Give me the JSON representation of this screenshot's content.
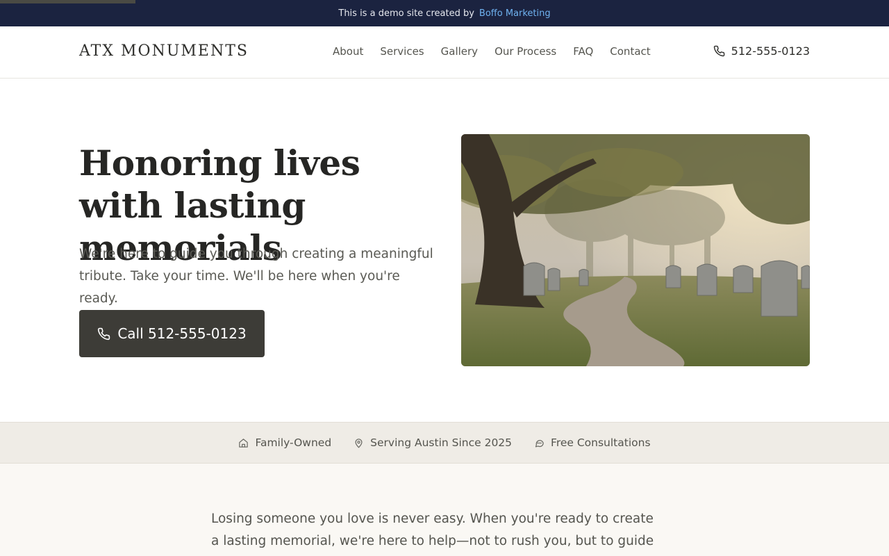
{
  "banner": {
    "text": "This is a demo site created by",
    "link": "Boffo Marketing"
  },
  "header": {
    "logo": "ATX MONUMENTS",
    "nav": [
      "About",
      "Services",
      "Gallery",
      "Our Process",
      "FAQ",
      "Contact"
    ],
    "phone": "512-555-0123"
  },
  "hero": {
    "title": "Honoring lives with lasting memorials",
    "subtitle": "We're here to guide you through creating a meaningful tribute. Take your time. We'll be here when you're ready.",
    "cta": "Call 512-555-0123",
    "image_icon": "cemetery-path-photo"
  },
  "trust": [
    {
      "icon": "home-icon",
      "label": "Family-Owned"
    },
    {
      "icon": "location-pin-icon",
      "label": "Serving Austin Since 2025"
    },
    {
      "icon": "chat-bubble-icon",
      "label": "Free Consultations"
    }
  ],
  "intro": {
    "text": "Losing someone you love is never easy. When you're ready to create a lasting memorial, we're here to help—not to rush you, but to guide you"
  },
  "colors": {
    "banner_bg": "#1b2340",
    "banner_link": "#6fb2f0",
    "button_bg": "#3d3c37",
    "strip_bg": "#efece6"
  }
}
